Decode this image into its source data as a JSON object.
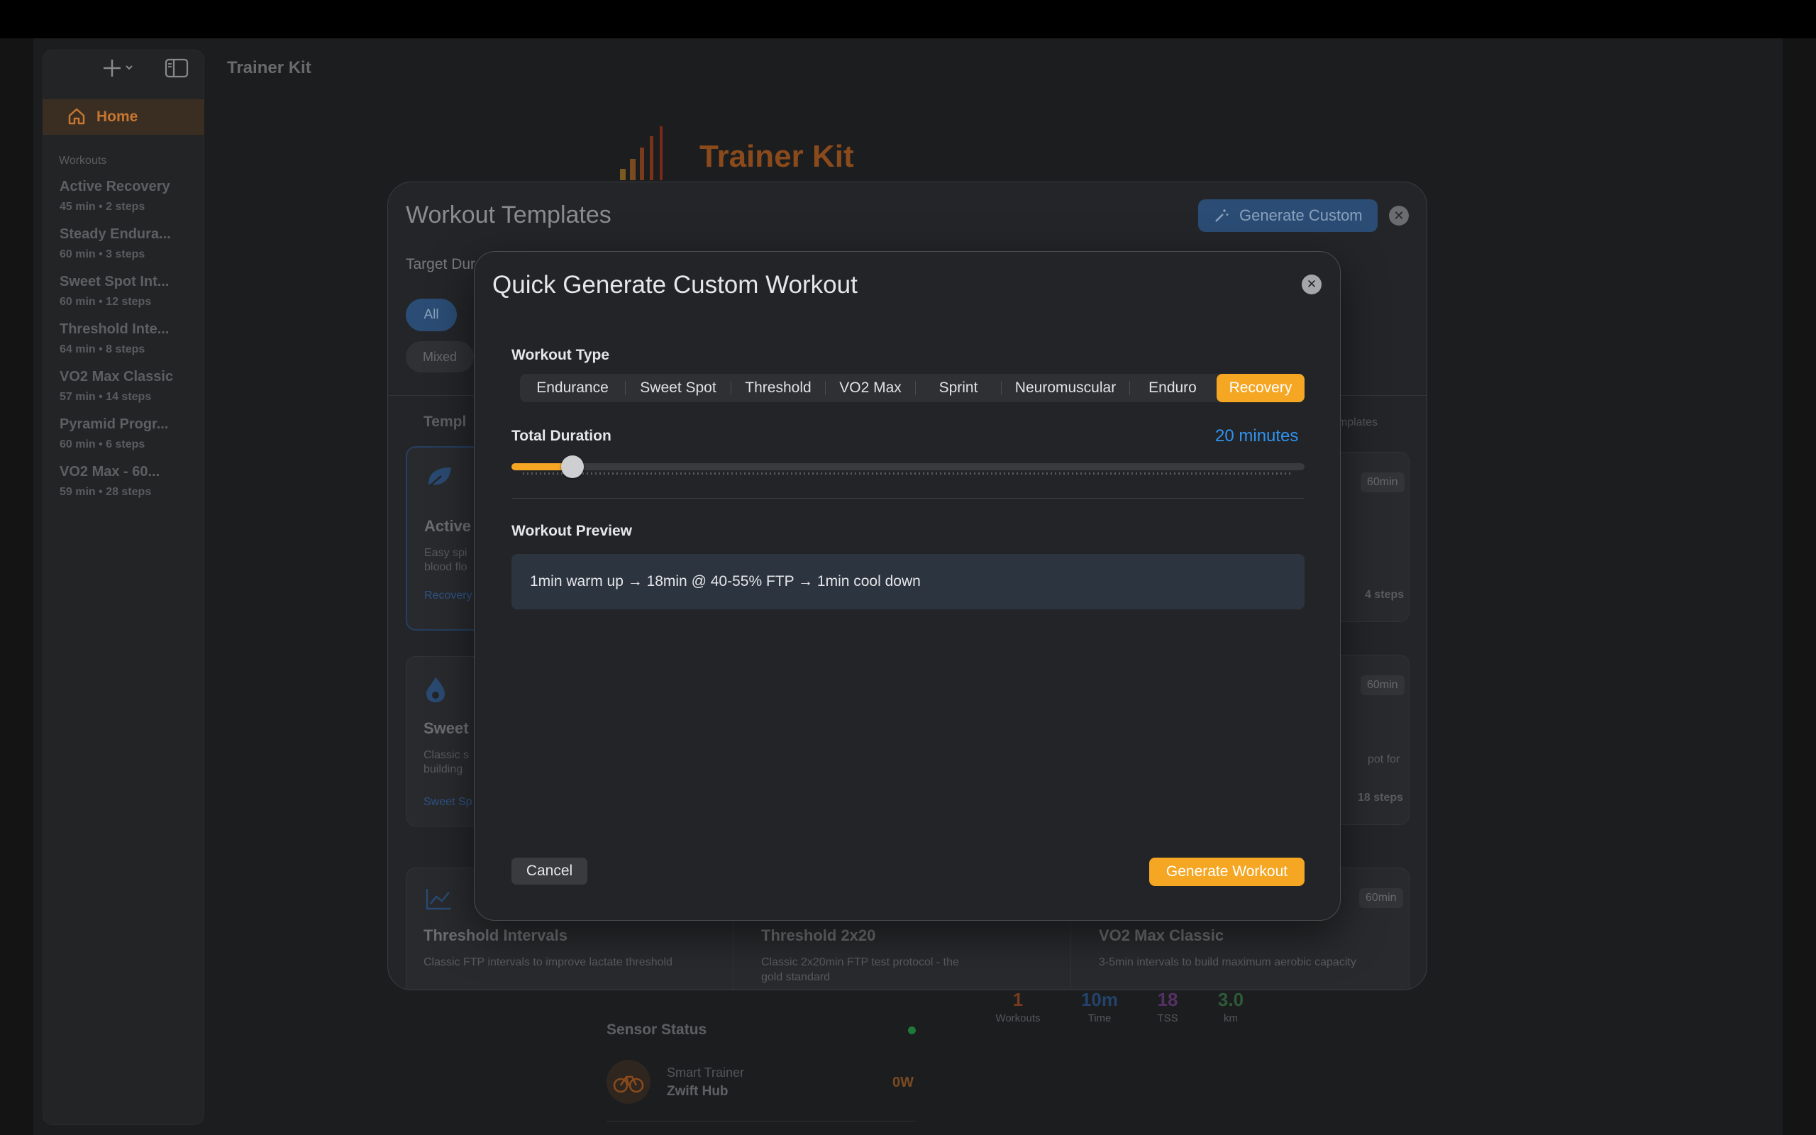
{
  "app": {
    "title": "Trainer Kit"
  },
  "sidebar": {
    "home_label": "Home",
    "section_label": "Workouts",
    "items": [
      {
        "title": "Active Recovery",
        "sub": "45 min • 2 steps"
      },
      {
        "title": "Steady Endura...",
        "sub": "60 min • 3 steps"
      },
      {
        "title": "Sweet Spot Int...",
        "sub": "60 min • 12 steps"
      },
      {
        "title": "Threshold Inte...",
        "sub": "64 min • 8 steps"
      },
      {
        "title": "VO2 Max Classic",
        "sub": "57 min • 14 steps"
      },
      {
        "title": "Pyramid Progr...",
        "sub": "60 min • 6 steps"
      },
      {
        "title": "VO2 Max - 60...",
        "sub": "59 min • 28 steps"
      }
    ]
  },
  "home": {
    "brand": "Trainer Kit",
    "stats": [
      {
        "value": "1",
        "label": "Workouts",
        "color": "#7a3a20"
      },
      {
        "value": "10m",
        "label": "Time",
        "color": "#23436b"
      },
      {
        "value": "18",
        "label": "TSS",
        "color": "#553066"
      },
      {
        "value": "3.0",
        "label": "km",
        "color": "#2f5a38"
      }
    ],
    "sensor": {
      "title": "Sensor Status",
      "device_type": "Smart Trainer",
      "device_name": "Zwift Hub",
      "power": "0W"
    }
  },
  "templates": {
    "title": "Workout Templates",
    "generate_custom": "Generate Custom",
    "target_duration": "Target Dur",
    "filter_all": "All",
    "filter_mixed": "Mixed",
    "section": "Templ",
    "count_text": "emplates",
    "cards": [
      {
        "title": "Active",
        "desc1": "Easy spi",
        "desc2": "blood flo",
        "cat": "Recovery"
      },
      {
        "title": "Sweet",
        "desc1": "Classic s",
        "desc2": "building",
        "cat": "Sweet Sp"
      },
      {
        "badge": "60min",
        "steps": "4 steps"
      },
      {
        "badge": "60min",
        "desc1": "pot for",
        "steps": "18 steps"
      },
      {
        "title": "Threshold Intervals",
        "desc1": "Classic FTP intervals to improve lactate threshold"
      },
      {
        "title": "Threshold 2x20",
        "desc1": "Classic 2x20min FTP test protocol - the",
        "desc2": "gold standard"
      },
      {
        "title": "VO2 Max Classic",
        "desc1": "3-5min intervals to build maximum aerobic capacity",
        "badge": "60min"
      }
    ]
  },
  "modal": {
    "title": "Quick Generate Custom Workout",
    "workout_type_label": "Workout Type",
    "types": [
      "Endurance",
      "Sweet Spot",
      "Threshold",
      "VO2 Max",
      "Sprint",
      "Neuromuscular",
      "Enduro",
      "Recovery"
    ],
    "selected_type": "Recovery",
    "duration_label": "Total Duration",
    "duration_value": "20 minutes",
    "duration_fraction": 0.07,
    "preview_label": "Workout Preview",
    "preview_text": "1min warm up → 18min @ 40-55% FTP → 1min cool down",
    "cancel": "Cancel",
    "generate": "Generate Workout",
    "accent": "#f5a623",
    "link_color": "#2f93f0"
  }
}
